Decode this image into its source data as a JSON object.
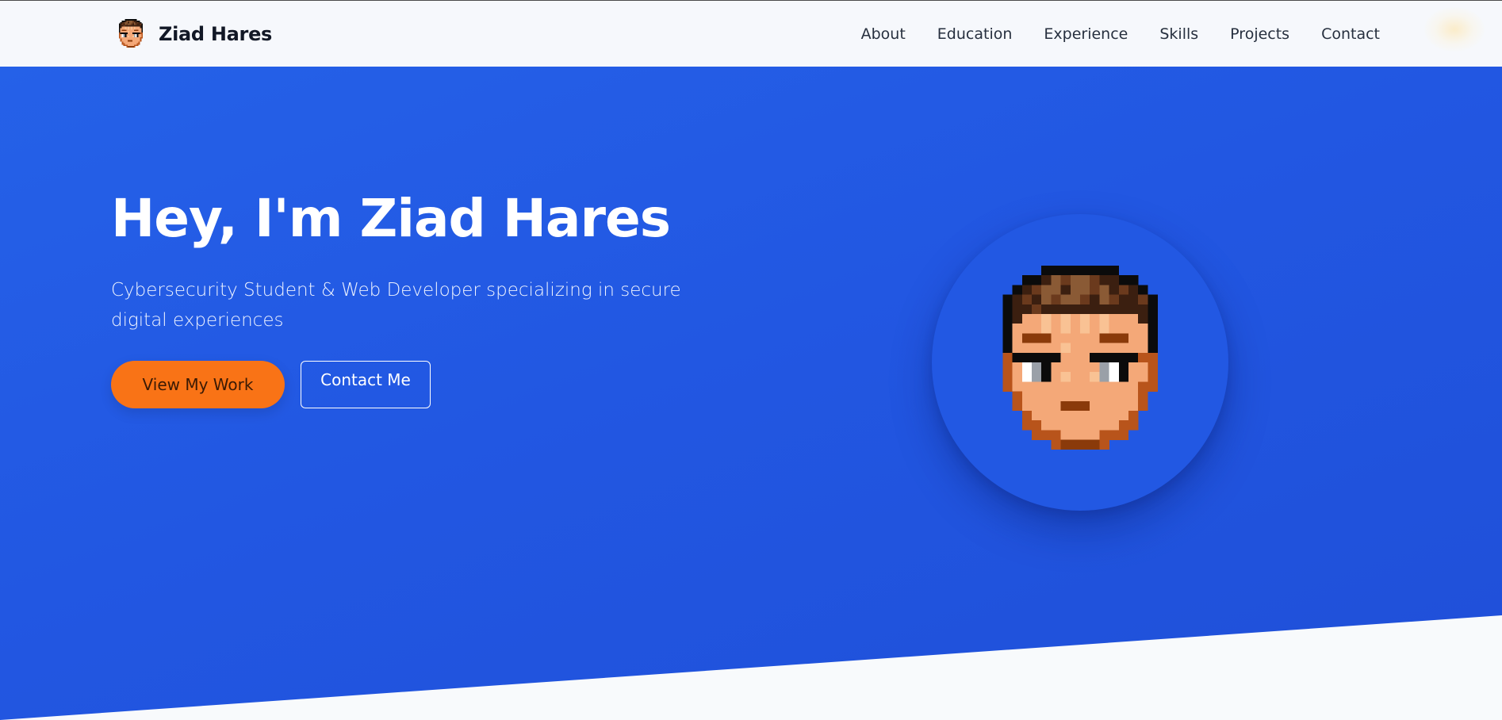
{
  "navbar": {
    "brand_name": "Ziad Hares",
    "links": [
      {
        "label": "About"
      },
      {
        "label": "Education"
      },
      {
        "label": "Experience"
      },
      {
        "label": "Skills"
      },
      {
        "label": "Projects"
      },
      {
        "label": "Contact"
      }
    ]
  },
  "hero": {
    "title": "Hey, I'm Ziad Hares",
    "subtitle": "Cybersecurity Student & Web Developer specializing in secure digital experiences",
    "primary_button": "View My Work",
    "secondary_button": "Contact Me",
    "avatar_icon": "pixel-avatar-icon"
  },
  "colors": {
    "hero_blue": "#2563eb",
    "accent_orange": "#f97316",
    "navbar_bg": "#f6f8fc",
    "page_bg": "#f8fafc"
  }
}
